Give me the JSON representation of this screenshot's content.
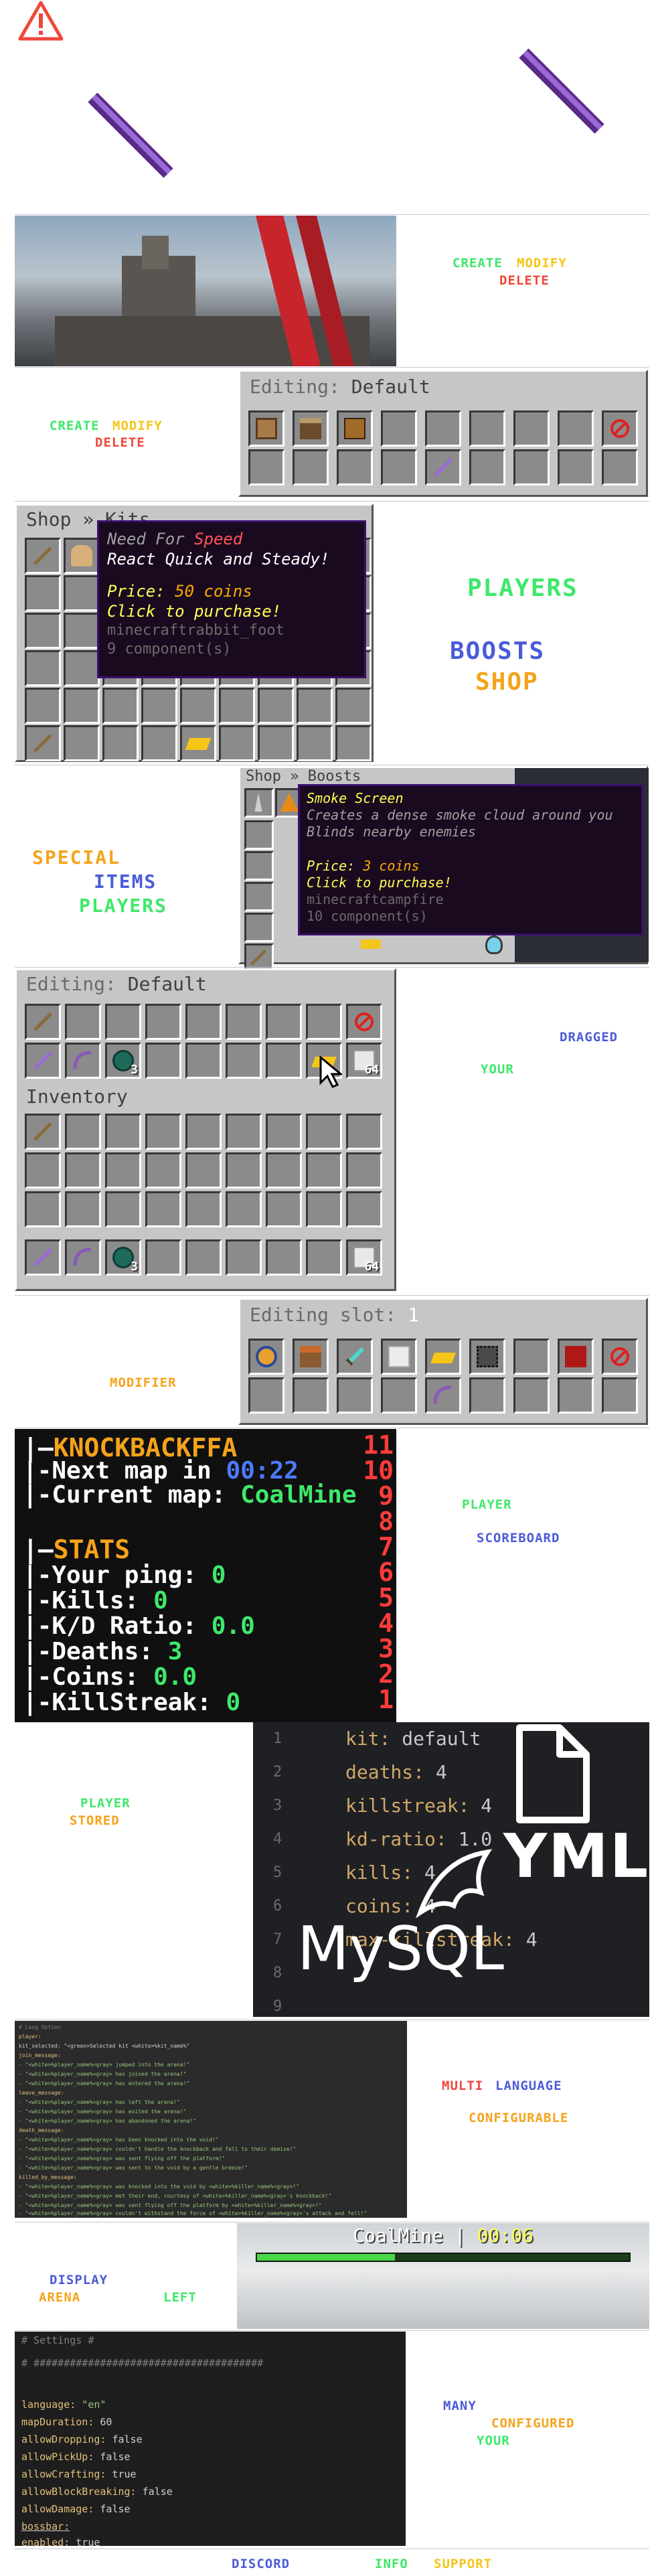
{
  "header": {
    "warning_icon": "warning-triangle-icon",
    "left_item_icon": "enchanted-stick-icon",
    "right_item_icon": "enchanted-stick-icon"
  },
  "arena_section": {
    "labels": {
      "create": "CREATE",
      "modify": "MODIFY",
      "delete": "DELETE"
    }
  },
  "kit_editor_section": {
    "labels": {
      "create": "CREATE",
      "modify": "MODIFY",
      "delete": "DELETE"
    },
    "gui": {
      "title_prefix": "Editing: ",
      "title_value": "Default"
    }
  },
  "shop_section": {
    "gui_title": "Shop » Kits",
    "tooltip": {
      "line1_prefix": "Need For ",
      "line1_value": "Speed",
      "line2": "React Quick and Steady!",
      "price_prefix": "Price: ",
      "price_value": "50 coins",
      "action": "Click to purchase!",
      "id": "minecraftrabbit_foot",
      "components": "9 component(s)"
    },
    "labels": {
      "players": "PLAYERS",
      "boosts": "BOOSTS",
      "shop": "SHOP"
    }
  },
  "boosts_section": {
    "labels": {
      "special": "SPECIAL",
      "items": "ITEMS",
      "players": "PLAYERS"
    },
    "gui_title": "Shop » Boosts",
    "tooltip": {
      "name": "Smoke Screen",
      "desc1": "Creates a dense smoke cloud around you",
      "desc2": "Blinds nearby enemies",
      "price_prefix": "Price: ",
      "price_value": "3 coins",
      "action": "Click to purchase!",
      "id": "minecraftcampfire",
      "components": "10 component(s)"
    }
  },
  "inventory_section": {
    "gui_title_prefix": "Editing: ",
    "gui_title_value": "Default",
    "inventory_label": "Inventory",
    "counts": {
      "pearls": "3",
      "blocks": "64"
    },
    "labels": {
      "dragged": "DRAGGED",
      "your": "YOUR"
    }
  },
  "slot_section": {
    "labels": {
      "modifier": "MODIFIER"
    },
    "gui_title_prefix": "Editing slot: ",
    "gui_title_value": "1"
  },
  "scoreboard_section": {
    "board": {
      "title": "KNOCKBACKFFA",
      "next_map_label": "Next map in ",
      "next_map_value": "00:22",
      "current_map_label": "Current map: ",
      "current_map_value": "CoalMine",
      "stats_title": "STATS",
      "ping_label": "Your ping: ",
      "ping_value": "0",
      "kills_label": "Kills: ",
      "kills_value": "0",
      "kd_label": "K/D Ratio: ",
      "kd_value": "0.0",
      "deaths_label": "Deaths: ",
      "deaths_value": "3",
      "coins_label": "Coins: ",
      "coins_value": "0.0",
      "streak_label": "KillStreak: ",
      "streak_value": "0",
      "numbers": [
        "11",
        "10",
        "9",
        "8",
        "7",
        "6",
        "5",
        "4",
        "3",
        "2",
        "1"
      ]
    },
    "labels": {
      "player": "PLAYER",
      "scoreboard": "SCOREBOARD"
    }
  },
  "storage_section": {
    "labels": {
      "player": "PLAYER",
      "stored": "STORED"
    },
    "code_lines": [
      {
        "n": "1",
        "key": "kit:",
        "val": " default"
      },
      {
        "n": "2",
        "key": "deaths:",
        "val": " 4"
      },
      {
        "n": "3",
        "key": "killstreak:",
        "val": " 4"
      },
      {
        "n": "4",
        "key": "kd-ratio:",
        "val": " 1.0"
      },
      {
        "n": "5",
        "key": "kills:",
        "val": " 4"
      },
      {
        "n": "6",
        "key": "coins:",
        "val": " 4"
      },
      {
        "n": "7",
        "key": "max-killstreak:",
        "val": " 4"
      },
      {
        "n": "8",
        "key": "",
        "val": ""
      },
      {
        "n": "9",
        "key": "",
        "val": ""
      }
    ],
    "yml_text": "YML",
    "mysql_text": "MySQL"
  },
  "language_section": {
    "labels": {
      "multi": "MULTI",
      "language": "LANGUAGE",
      "configurable": "CONFIGURABLE"
    },
    "lines": [
      {
        "t": "# Lang Option",
        "c": "#7f7f7f"
      },
      {
        "t": "player:",
        "c": "#e3c07b"
      },
      {
        "t": "  kit_selected: \"<green>Selected kit <white>%kit_name%\"",
        "c": "#cfcfcf"
      },
      {
        "t": "  join_message:",
        "c": "#e3c07b"
      },
      {
        "t": "    - \"<white>%player_name%<gray> jumped into the arena!\"",
        "c": "#98c379"
      },
      {
        "t": "    - \"<white>%player_name%<gray> has joined the arena!\"",
        "c": "#98c379"
      },
      {
        "t": "    - \"<white>%player_name%<gray> has entered the arena!\"",
        "c": "#98c379"
      },
      {
        "t": "  leave_message:",
        "c": "#e3c07b"
      },
      {
        "t": "    - \"<white>%player_name%<gray> has left the arena!\"",
        "c": "#98c379"
      },
      {
        "t": "    - \"<white>%player_name%<gray> has exited the arena!\"",
        "c": "#98c379"
      },
      {
        "t": "    - \"<white>%player_name%<gray> has abandoned the arena!\"",
        "c": "#98c379"
      },
      {
        "t": "  death_message:",
        "c": "#e3c07b"
      },
      {
        "t": "    - \"<white>%player_name%<gray> has been knocked into the void!\"",
        "c": "#98c379"
      },
      {
        "t": "    - \"<white>%player_name%<gray> couldn't handle the knockback and fell to their demise!\"",
        "c": "#98c379"
      },
      {
        "t": "    - \"<white>%player_name%<gray> was sent flying off the platform!\"",
        "c": "#98c379"
      },
      {
        "t": "    - \"<white>%player_name%<gray> was sent to the void by a gentle breeze!\"",
        "c": "#98c379"
      },
      {
        "t": "  killed_by_message:",
        "c": "#e3c07b"
      },
      {
        "t": "    - \"<white>%player_name%<gray> was knocked into the void by <white>%killer_name%<gray>!\"",
        "c": "#98c379"
      },
      {
        "t": "    - \"<white>%player_name%<gray> met their end, courtesy of <white>%killer_name%<gray>'s knockback!\"",
        "c": "#98c379"
      },
      {
        "t": "    - \"<white>%player_name%<gray> was sent flying off the platform by <white>%killer_name%<gray>!\"",
        "c": "#98c379"
      },
      {
        "t": "    - \"<white>%player_name%<gray> couldn't withstand the force of <white>%killer_name%<gray>'s attack and fell!\"",
        "c": "#98c379"
      }
    ]
  },
  "arena_bar_section": {
    "labels": {
      "display": "DISPLAY",
      "arena": "ARENA",
      "left": "LEFT"
    },
    "bossbar_map": "CoalMine",
    "bossbar_sep": " | ",
    "bossbar_time": "00:06",
    "bossbar_progress": 0.37
  },
  "config_section": {
    "lines": [
      {
        "t": "#                Settings               #",
        "cls": "c"
      },
      {
        "t": "# ######################################",
        "cls": "c"
      },
      {
        "t": "",
        "cls": ""
      },
      {
        "k": "language:",
        "v": " \"en\""
      },
      {
        "k": "mapDuration:",
        "v": " 60"
      },
      {
        "k": "allowDropping:",
        "v": " false"
      },
      {
        "k": "allowPickUp:",
        "v": " false"
      },
      {
        "k": "allowCrafting:",
        "v": " true"
      },
      {
        "k": "allowBlockBreaking:",
        "v": " false"
      },
      {
        "k": "allowDamage:",
        "v": " false"
      },
      {
        "k": "bossbar:",
        "v": ""
      },
      {
        "k": "  enabled:",
        "v": " true"
      }
    ],
    "labels": {
      "many": "MANY",
      "configured": "CONFIGURED",
      "your": "YOUR"
    }
  },
  "footer": {
    "discord": "DISCORD",
    "info": "INFO",
    "support": "SUPPORT"
  },
  "colors": {
    "green": "#3ee86a",
    "yellow": "#f5c518",
    "red": "#f0473b",
    "blue": "#4b5bd8",
    "orange": "#f5a31a"
  }
}
